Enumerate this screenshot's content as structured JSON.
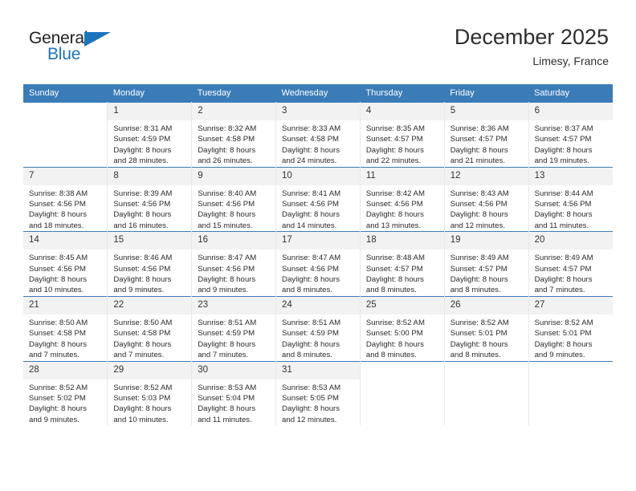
{
  "logo": {
    "text_primary": "General",
    "text_secondary": "Blue",
    "primary_color": "#231f20",
    "accent_color": "#1b75bb"
  },
  "header": {
    "title": "December 2025",
    "location": "Limesy, France"
  },
  "theme": {
    "header_row_bg": "#3a7cb8",
    "daynum_bg": "#f2f2f2",
    "row_divider": "#3a7cb8",
    "column_divider": "#e8e8e8"
  },
  "weekday_headers": [
    "Sunday",
    "Monday",
    "Tuesday",
    "Wednesday",
    "Thursday",
    "Friday",
    "Saturday"
  ],
  "weeks": [
    [
      {
        "day": "",
        "sunrise": "",
        "sunset": "",
        "daylight_line1": "",
        "daylight_line2": ""
      },
      {
        "day": "1",
        "sunrise": "Sunrise: 8:31 AM",
        "sunset": "Sunset: 4:59 PM",
        "daylight_line1": "Daylight: 8 hours",
        "daylight_line2": "and 28 minutes."
      },
      {
        "day": "2",
        "sunrise": "Sunrise: 8:32 AM",
        "sunset": "Sunset: 4:58 PM",
        "daylight_line1": "Daylight: 8 hours",
        "daylight_line2": "and 26 minutes."
      },
      {
        "day": "3",
        "sunrise": "Sunrise: 8:33 AM",
        "sunset": "Sunset: 4:58 PM",
        "daylight_line1": "Daylight: 8 hours",
        "daylight_line2": "and 24 minutes."
      },
      {
        "day": "4",
        "sunrise": "Sunrise: 8:35 AM",
        "sunset": "Sunset: 4:57 PM",
        "daylight_line1": "Daylight: 8 hours",
        "daylight_line2": "and 22 minutes."
      },
      {
        "day": "5",
        "sunrise": "Sunrise: 8:36 AM",
        "sunset": "Sunset: 4:57 PM",
        "daylight_line1": "Daylight: 8 hours",
        "daylight_line2": "and 21 minutes."
      },
      {
        "day": "6",
        "sunrise": "Sunrise: 8:37 AM",
        "sunset": "Sunset: 4:57 PM",
        "daylight_line1": "Daylight: 8 hours",
        "daylight_line2": "and 19 minutes."
      }
    ],
    [
      {
        "day": "7",
        "sunrise": "Sunrise: 8:38 AM",
        "sunset": "Sunset: 4:56 PM",
        "daylight_line1": "Daylight: 8 hours",
        "daylight_line2": "and 18 minutes."
      },
      {
        "day": "8",
        "sunrise": "Sunrise: 8:39 AM",
        "sunset": "Sunset: 4:56 PM",
        "daylight_line1": "Daylight: 8 hours",
        "daylight_line2": "and 16 minutes."
      },
      {
        "day": "9",
        "sunrise": "Sunrise: 8:40 AM",
        "sunset": "Sunset: 4:56 PM",
        "daylight_line1": "Daylight: 8 hours",
        "daylight_line2": "and 15 minutes."
      },
      {
        "day": "10",
        "sunrise": "Sunrise: 8:41 AM",
        "sunset": "Sunset: 4:56 PM",
        "daylight_line1": "Daylight: 8 hours",
        "daylight_line2": "and 14 minutes."
      },
      {
        "day": "11",
        "sunrise": "Sunrise: 8:42 AM",
        "sunset": "Sunset: 4:56 PM",
        "daylight_line1": "Daylight: 8 hours",
        "daylight_line2": "and 13 minutes."
      },
      {
        "day": "12",
        "sunrise": "Sunrise: 8:43 AM",
        "sunset": "Sunset: 4:56 PM",
        "daylight_line1": "Daylight: 8 hours",
        "daylight_line2": "and 12 minutes."
      },
      {
        "day": "13",
        "sunrise": "Sunrise: 8:44 AM",
        "sunset": "Sunset: 4:56 PM",
        "daylight_line1": "Daylight: 8 hours",
        "daylight_line2": "and 11 minutes."
      }
    ],
    [
      {
        "day": "14",
        "sunrise": "Sunrise: 8:45 AM",
        "sunset": "Sunset: 4:56 PM",
        "daylight_line1": "Daylight: 8 hours",
        "daylight_line2": "and 10 minutes."
      },
      {
        "day": "15",
        "sunrise": "Sunrise: 8:46 AM",
        "sunset": "Sunset: 4:56 PM",
        "daylight_line1": "Daylight: 8 hours",
        "daylight_line2": "and 9 minutes."
      },
      {
        "day": "16",
        "sunrise": "Sunrise: 8:47 AM",
        "sunset": "Sunset: 4:56 PM",
        "daylight_line1": "Daylight: 8 hours",
        "daylight_line2": "and 9 minutes."
      },
      {
        "day": "17",
        "sunrise": "Sunrise: 8:47 AM",
        "sunset": "Sunset: 4:56 PM",
        "daylight_line1": "Daylight: 8 hours",
        "daylight_line2": "and 8 minutes."
      },
      {
        "day": "18",
        "sunrise": "Sunrise: 8:48 AM",
        "sunset": "Sunset: 4:57 PM",
        "daylight_line1": "Daylight: 8 hours",
        "daylight_line2": "and 8 minutes."
      },
      {
        "day": "19",
        "sunrise": "Sunrise: 8:49 AM",
        "sunset": "Sunset: 4:57 PM",
        "daylight_line1": "Daylight: 8 hours",
        "daylight_line2": "and 8 minutes."
      },
      {
        "day": "20",
        "sunrise": "Sunrise: 8:49 AM",
        "sunset": "Sunset: 4:57 PM",
        "daylight_line1": "Daylight: 8 hours",
        "daylight_line2": "and 7 minutes."
      }
    ],
    [
      {
        "day": "21",
        "sunrise": "Sunrise: 8:50 AM",
        "sunset": "Sunset: 4:58 PM",
        "daylight_line1": "Daylight: 8 hours",
        "daylight_line2": "and 7 minutes."
      },
      {
        "day": "22",
        "sunrise": "Sunrise: 8:50 AM",
        "sunset": "Sunset: 4:58 PM",
        "daylight_line1": "Daylight: 8 hours",
        "daylight_line2": "and 7 minutes."
      },
      {
        "day": "23",
        "sunrise": "Sunrise: 8:51 AM",
        "sunset": "Sunset: 4:59 PM",
        "daylight_line1": "Daylight: 8 hours",
        "daylight_line2": "and 7 minutes."
      },
      {
        "day": "24",
        "sunrise": "Sunrise: 8:51 AM",
        "sunset": "Sunset: 4:59 PM",
        "daylight_line1": "Daylight: 8 hours",
        "daylight_line2": "and 8 minutes."
      },
      {
        "day": "25",
        "sunrise": "Sunrise: 8:52 AM",
        "sunset": "Sunset: 5:00 PM",
        "daylight_line1": "Daylight: 8 hours",
        "daylight_line2": "and 8 minutes."
      },
      {
        "day": "26",
        "sunrise": "Sunrise: 8:52 AM",
        "sunset": "Sunset: 5:01 PM",
        "daylight_line1": "Daylight: 8 hours",
        "daylight_line2": "and 8 minutes."
      },
      {
        "day": "27",
        "sunrise": "Sunrise: 8:52 AM",
        "sunset": "Sunset: 5:01 PM",
        "daylight_line1": "Daylight: 8 hours",
        "daylight_line2": "and 9 minutes."
      }
    ],
    [
      {
        "day": "28",
        "sunrise": "Sunrise: 8:52 AM",
        "sunset": "Sunset: 5:02 PM",
        "daylight_line1": "Daylight: 8 hours",
        "daylight_line2": "and 9 minutes."
      },
      {
        "day": "29",
        "sunrise": "Sunrise: 8:52 AM",
        "sunset": "Sunset: 5:03 PM",
        "daylight_line1": "Daylight: 8 hours",
        "daylight_line2": "and 10 minutes."
      },
      {
        "day": "30",
        "sunrise": "Sunrise: 8:53 AM",
        "sunset": "Sunset: 5:04 PM",
        "daylight_line1": "Daylight: 8 hours",
        "daylight_line2": "and 11 minutes."
      },
      {
        "day": "31",
        "sunrise": "Sunrise: 8:53 AM",
        "sunset": "Sunset: 5:05 PM",
        "daylight_line1": "Daylight: 8 hours",
        "daylight_line2": "and 12 minutes."
      },
      {
        "day": "",
        "sunrise": "",
        "sunset": "",
        "daylight_line1": "",
        "daylight_line2": ""
      },
      {
        "day": "",
        "sunrise": "",
        "sunset": "",
        "daylight_line1": "",
        "daylight_line2": ""
      },
      {
        "day": "",
        "sunrise": "",
        "sunset": "",
        "daylight_line1": "",
        "daylight_line2": ""
      }
    ]
  ]
}
